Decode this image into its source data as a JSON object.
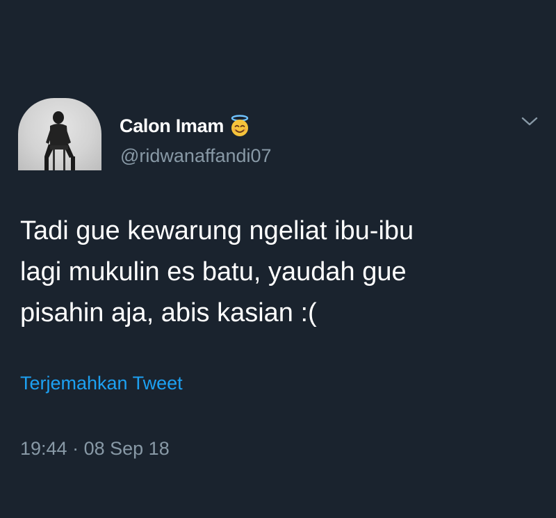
{
  "tweet": {
    "author": {
      "display_name": "Calon Imam",
      "name_emoji": "smiling-face-with-halo-emoji",
      "handle": "@ridwanaffandi07"
    },
    "text_lines": [
      "Tadi gue kewarung ngeliat ibu-ibu",
      "lagi mukulin es batu, yaudah gue",
      "pisahin aja, abis kasian :("
    ],
    "translate_label": "Terjemahkan Tweet",
    "time": "19:44",
    "separator": "·",
    "date": "08 Sep 18"
  },
  "icons": {
    "menu": "chevron-down-icon"
  },
  "colors": {
    "background": "#1a232e",
    "primary_text": "#ffffff",
    "secondary_text": "#8899a6",
    "link": "#1da1f2"
  }
}
